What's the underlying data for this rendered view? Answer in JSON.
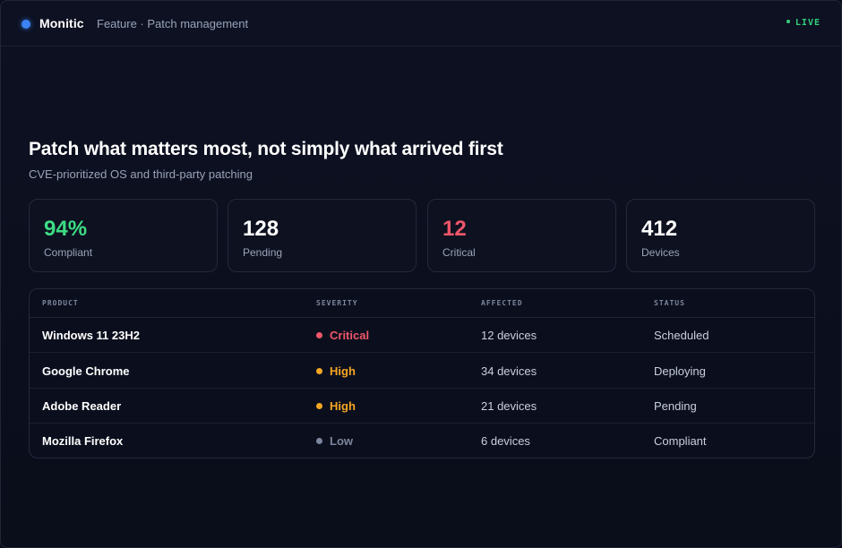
{
  "header": {
    "brand": "Monitic",
    "breadcrumb": "Feature · Patch management",
    "live_label": "LIVE"
  },
  "hero": {
    "title": "Patch what matters most, not simply what arrived first",
    "subtitle": "CVE-prioritized OS and third-party patching"
  },
  "stats": [
    {
      "value": "94%",
      "label": "Compliant",
      "color": "#3ddc84"
    },
    {
      "value": "128",
      "label": "Pending",
      "color": "#ffffff"
    },
    {
      "value": "12",
      "label": "Critical",
      "color": "#f0566a"
    },
    {
      "value": "412",
      "label": "Devices",
      "color": "#ffffff"
    }
  ],
  "table": {
    "columns": [
      "PRODUCT",
      "SEVERITY",
      "AFFECTED",
      "STATUS"
    ],
    "rows": [
      {
        "product": "Windows 11 23H2",
        "severity": "Critical",
        "severity_color": "#f0566a",
        "affected": "12 devices",
        "status": "Scheduled"
      },
      {
        "product": "Google Chrome",
        "severity": "High",
        "severity_color": "#f5a623",
        "affected": "34 devices",
        "status": "Deploying"
      },
      {
        "product": "Adobe Reader",
        "severity": "High",
        "severity_color": "#f5a623",
        "affected": "21 devices",
        "status": "Pending"
      },
      {
        "product": "Mozilla Firefox",
        "severity": "Low",
        "severity_color": "#7c869d",
        "affected": "6 devices",
        "status": "Compliant"
      }
    ]
  },
  "colors": {
    "accent": "#3b82f6",
    "live": "#34d17a"
  }
}
